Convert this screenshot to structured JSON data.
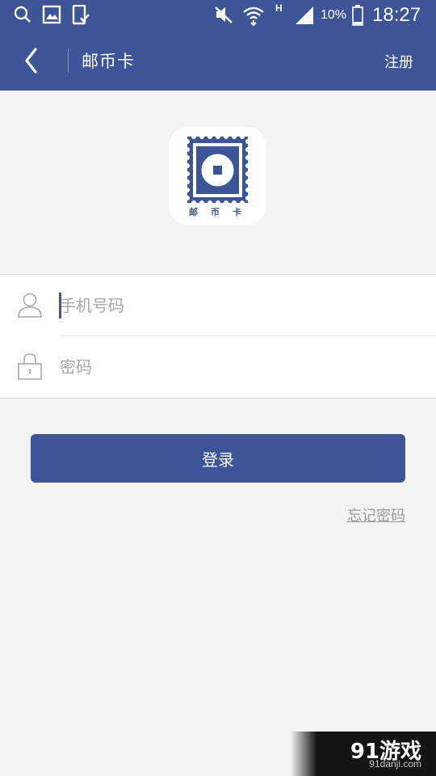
{
  "status_bar": {
    "battery": "10%",
    "time": "18:27",
    "network_type": "H",
    "icons": [
      "search-icon",
      "image-icon",
      "phone-check-icon",
      "mute-icon",
      "wifi-icon",
      "signal-icon",
      "battery-icon"
    ]
  },
  "app_bar": {
    "title": "邮币卡",
    "action_label": "注册"
  },
  "logo": {
    "text": "邮 币 卡",
    "color": "#3d5597"
  },
  "form": {
    "phone_placeholder": "手机号码",
    "phone_value": "",
    "password_placeholder": "密码",
    "password_value": ""
  },
  "login_button": {
    "label": "登录"
  },
  "forgot_password": {
    "label": "忘记密码"
  },
  "watermark": {
    "brand": "91游戏",
    "url": "91danji.com"
  },
  "colors": {
    "primary": "#3d5597",
    "background": "#f3f3f3",
    "placeholder": "#a8a8a8",
    "link": "#9a9a9a"
  }
}
